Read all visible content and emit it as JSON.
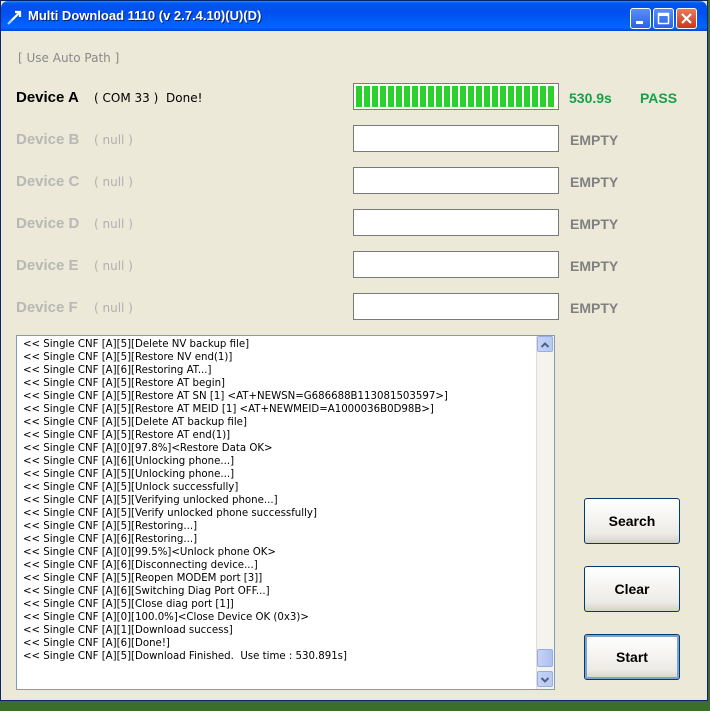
{
  "window": {
    "title": "Multi Download 1110 (v 2.7.4.10)(U)(D)"
  },
  "auto_path_label": "[ Use Auto Path ]",
  "devices": [
    {
      "name": "Device A",
      "port": "( COM 33 )",
      "status": "Done!",
      "progress": 1.0,
      "time": "530.9s",
      "result": "PASS"
    },
    {
      "name": "Device B",
      "port": "( null )",
      "status": "",
      "progress": 0,
      "time": "",
      "result": "EMPTY"
    },
    {
      "name": "Device C",
      "port": "( null )",
      "status": "",
      "progress": 0,
      "time": "",
      "result": "EMPTY"
    },
    {
      "name": "Device D",
      "port": "( null )",
      "status": "",
      "progress": 0,
      "time": "",
      "result": "EMPTY"
    },
    {
      "name": "Device E",
      "port": "( null )",
      "status": "",
      "progress": 0,
      "time": "",
      "result": "EMPTY"
    },
    {
      "name": "Device F",
      "port": "( null )",
      "status": "",
      "progress": 0,
      "time": "",
      "result": "EMPTY"
    }
  ],
  "log": [
    "<< Single CNF [A][5][Delete NV backup file]",
    "<< Single CNF [A][5][Restore NV end(1)]",
    "<< Single CNF [A][6][Restoring AT...]",
    "<< Single CNF [A][5][Restore AT begin]",
    "<< Single CNF [A][5][Restore AT SN [1] <AT+NEWSN=G686688B113081503597>]",
    "<< Single CNF [A][5][Restore AT MEID [1] <AT+NEWMEID=A1000036B0D98B>]",
    "<< Single CNF [A][5][Delete AT backup file]",
    "<< Single CNF [A][5][Restore AT end(1)]",
    "<< Single CNF [A][0][97.8%]<Restore Data OK>",
    "<< Single CNF [A][6][Unlocking phone...]",
    "<< Single CNF [A][5][Unlocking phone...]",
    "<< Single CNF [A][5][Unlock successfully]",
    "<< Single CNF [A][5][Verifying unlocked phone...]",
    "<< Single CNF [A][5][Verify unlocked phone successfully]",
    "<< Single CNF [A][5][Restoring...]",
    "<< Single CNF [A][6][Restoring...]",
    "<< Single CNF [A][0][99.5%]<Unlock phone OK>",
    "<< Single CNF [A][6][Disconnecting device...]",
    "<< Single CNF [A][5][Reopen MODEM port [3]]",
    "<< Single CNF [A][6][Switching Diag Port OFF...]",
    "<< Single CNF [A][5][Close diag port [1]]",
    "<< Single CNF [A][0][100.0%]<Close Device OK (0x3)>",
    "<< Single CNF [A][1][Download success]",
    "<< Single CNF [A][6][Done!]",
    "<< Single CNF [A][5][Download Finished.  Use time : 530.891s]"
  ],
  "buttons": {
    "search": "Search",
    "clear": "Clear",
    "start": "Start"
  },
  "icons": {
    "app": "download-arrow-icon",
    "minimize": "minimize-icon",
    "maximize": "maximize-icon",
    "close": "close-icon"
  },
  "colors": {
    "pass": "#18a04a",
    "progress": "#2bd02b",
    "titlebar": "#0053ee",
    "close": "#c7381c"
  }
}
